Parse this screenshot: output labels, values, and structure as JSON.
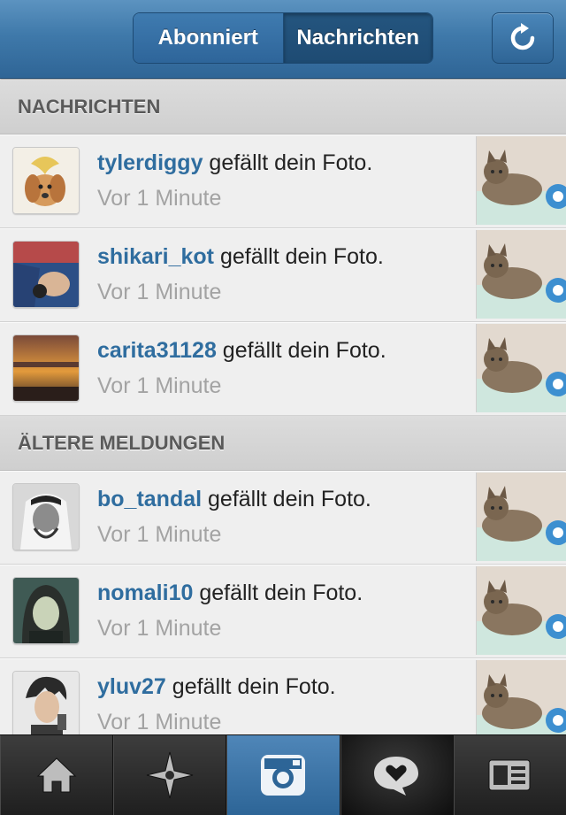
{
  "header": {
    "segments": [
      {
        "label": "Abonniert",
        "active": false
      },
      {
        "label": "Nachrichten",
        "active": true
      }
    ],
    "refresh_icon": "refresh-icon",
    "accent_color": "#3f79aa"
  },
  "sections": [
    {
      "title": "NACHRICHTEN",
      "items": [
        {
          "username": "tylerdiggy",
          "action": " gefällt dein Foto.",
          "time": "Vor 1 Minute"
        },
        {
          "username": "shikari_kot",
          "action": " gefällt dein Foto.",
          "time": "Vor 1 Minute"
        },
        {
          "username": "carita31128",
          "action": " gefällt dein Foto.",
          "time": "Vor 1 Minute"
        }
      ]
    },
    {
      "title": "ÄLTERE MELDUNGEN",
      "items": [
        {
          "username": "bo_tandal",
          "action": " gefällt dein Foto.",
          "time": "Vor 1 Minute"
        },
        {
          "username": "nomali10",
          "action": " gefällt dein Foto.",
          "time": "Vor 1 Minute"
        },
        {
          "username": "yluv27",
          "action": " gefällt dein Foto.",
          "time": "Vor 1 Minute"
        }
      ]
    }
  ],
  "tabbar": {
    "tabs": [
      {
        "icon": "home-icon",
        "active": false
      },
      {
        "icon": "explore-star-icon",
        "active": false
      },
      {
        "icon": "camera-icon",
        "active": false
      },
      {
        "icon": "news-heart-bubble-icon",
        "active": true
      },
      {
        "icon": "profile-card-icon",
        "active": false
      }
    ]
  }
}
